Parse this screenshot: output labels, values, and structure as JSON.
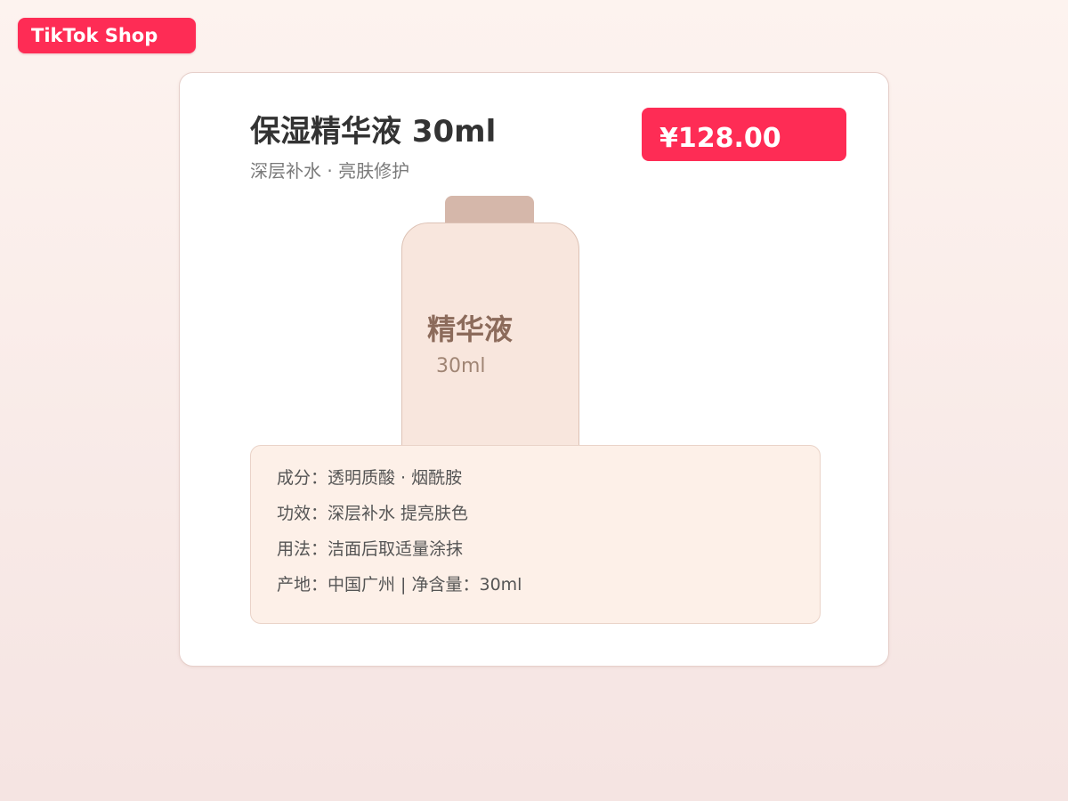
{
  "brand": {
    "label": "TikTok Shop"
  },
  "product": {
    "title": "保湿精华液 30ml",
    "subtitle": "深层补水 · 亮肤修护",
    "price": "¥128.00",
    "bottle_label": "精华液",
    "bottle_volume": "30ml",
    "details": [
      "成分：透明质酸 · 烟酰胺",
      "功效：深层补水 提亮肤色",
      "用法：洁面后取适量涂抹",
      "产地：中国广州 | 净含量：30ml"
    ]
  },
  "colors": {
    "accent": "#fe2c55",
    "background_top": "#fdf3ef",
    "background_bottom": "#f5e4e2",
    "bottle_body": "#f8e6dd",
    "bottle_cap": "#d5b7aa",
    "details_panel": "#fdf0e8"
  }
}
